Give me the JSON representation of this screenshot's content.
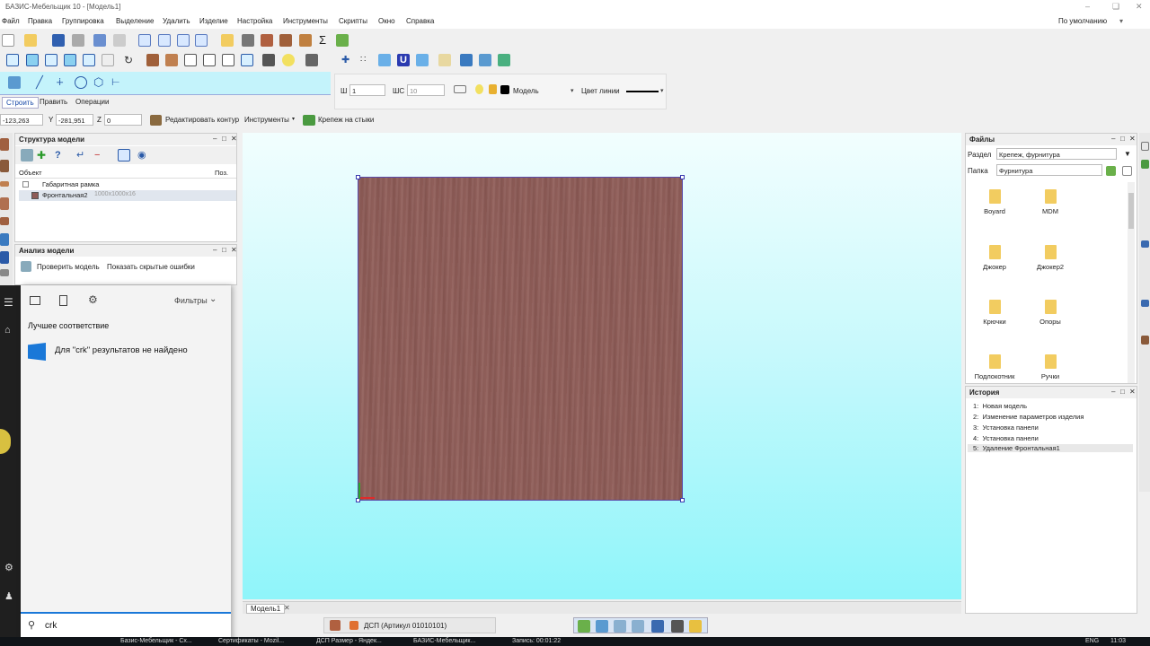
{
  "app": {
    "title": "БАЗИС-Мебельщик 10 - [Модель1]",
    "preset": "По умолчанию"
  },
  "menu": [
    "Файл",
    "Правка",
    "Группировка",
    "Выделение",
    "Удалить",
    "Изделие",
    "Настройка",
    "Инструменты",
    "Скрипты",
    "Окно",
    "Справка"
  ],
  "props": {
    "w_label": "Ш",
    "w_value": "1",
    "shs_label": "ШС",
    "shs_value": "10",
    "layer": "Модель",
    "line_color_label": "Цвет линии"
  },
  "mode_tabs": [
    "Строить",
    "Править",
    "Операции"
  ],
  "coords": {
    "x": "-123,263",
    "y_label": "Y",
    "y": "-281,951",
    "z_label": "Z",
    "z": "0",
    "edit_contour": "Редактировать контур",
    "tools": "Инструменты",
    "fastener": "Крепеж на стыки"
  },
  "structure": {
    "title": "Структура модели",
    "col_object": "Объект",
    "col_pos": "Поз.",
    "items": [
      {
        "label": "Габаритная рамка",
        "meta": ""
      },
      {
        "label": "Фронтальная2",
        "meta": "1000x1000x16"
      }
    ]
  },
  "analysis": {
    "title": "Анализ модели",
    "check": "Проверить модель",
    "show_errors": "Показать скрытые ошибки"
  },
  "search": {
    "filters": "Фильтры",
    "best_match": "Лучшее соответствие",
    "no_results": "Для \"crk\" результатов не найдено",
    "query": "crk"
  },
  "files": {
    "title": "Файлы",
    "section_label": "Раздел",
    "section_value": "Крепеж, фурнитура",
    "folder_label": "Папка",
    "folder_value": "Фурнитура",
    "items": [
      "Boyard",
      "MDM",
      "Джокер",
      "Джокер2",
      "Крючки",
      "Опоры",
      "Подлокотник",
      "Ручки"
    ]
  },
  "history": {
    "title": "История",
    "items": [
      {
        "num": "1:",
        "label": "Новая модель"
      },
      {
        "num": "2:",
        "label": "Изменение параметров изделия"
      },
      {
        "num": "3:",
        "label": "Установка панели"
      },
      {
        "num": "4:",
        "label": "Установка панели"
      },
      {
        "num": "5:",
        "label": "Удаление Фронтальная1"
      }
    ]
  },
  "doc_tab": "Модель1",
  "status": {
    "material": "ДСП (Артикул 01010101)"
  },
  "taskbar": {
    "items": [
      "Базис-Мебельщик - Сх...",
      "Сертификаты - Mozil...",
      "ДСП Размер - Яндек...",
      "БАЗИС-Мебельщик...",
      "Запись: 00:01:22"
    ],
    "lang": "ENG",
    "time": "11:03"
  },
  "colors": {
    "board": "#8e5b56",
    "canvas_top": "#f2fefe",
    "canvas_bottom": "#8ff5fa",
    "accent": "#1a4aa8"
  }
}
